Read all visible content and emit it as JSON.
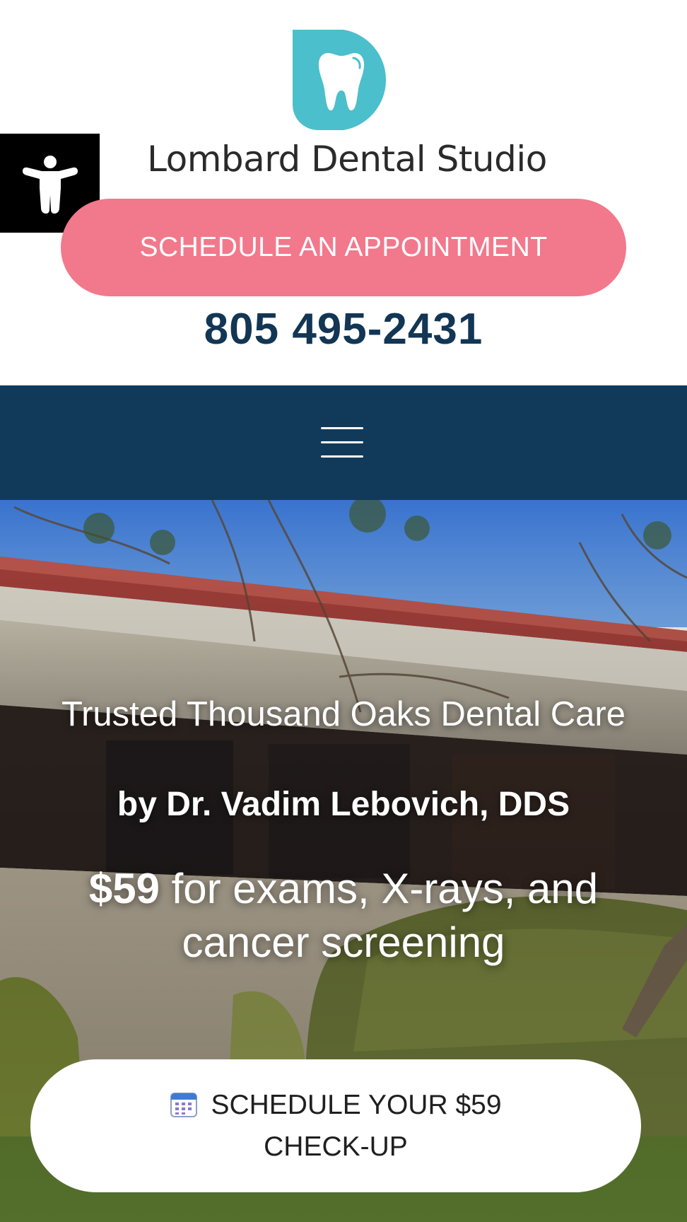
{
  "header": {
    "brand_name": "Lombard Dental Studio",
    "logo_icon": "tooth-logo-icon",
    "accessibility_icon": "accessibility-person-icon",
    "appointment_label": "SCHEDULE AN APPOINTMENT",
    "phone": "805 495-2431"
  },
  "nav": {
    "menu_icon": "hamburger-menu-icon"
  },
  "hero": {
    "title_line": "Trusted Thousand Oaks Dental Care",
    "doctor_line": "by Dr. Vadim Lebovich, DDS",
    "offer_price": "$59",
    "offer_rest": " for exams, X-rays, and cancer screening",
    "cta_icon": "calendar-icon",
    "cta_line1": "SCHEDULE YOUR $59",
    "cta_line2": "CHECK-UP"
  },
  "colors": {
    "logo_teal": "#4bbfcb",
    "appointment_pink": "#f2788c",
    "phone_navy": "#123654",
    "navbar_navy": "#113a5a",
    "accessibility_black": "#000000"
  }
}
